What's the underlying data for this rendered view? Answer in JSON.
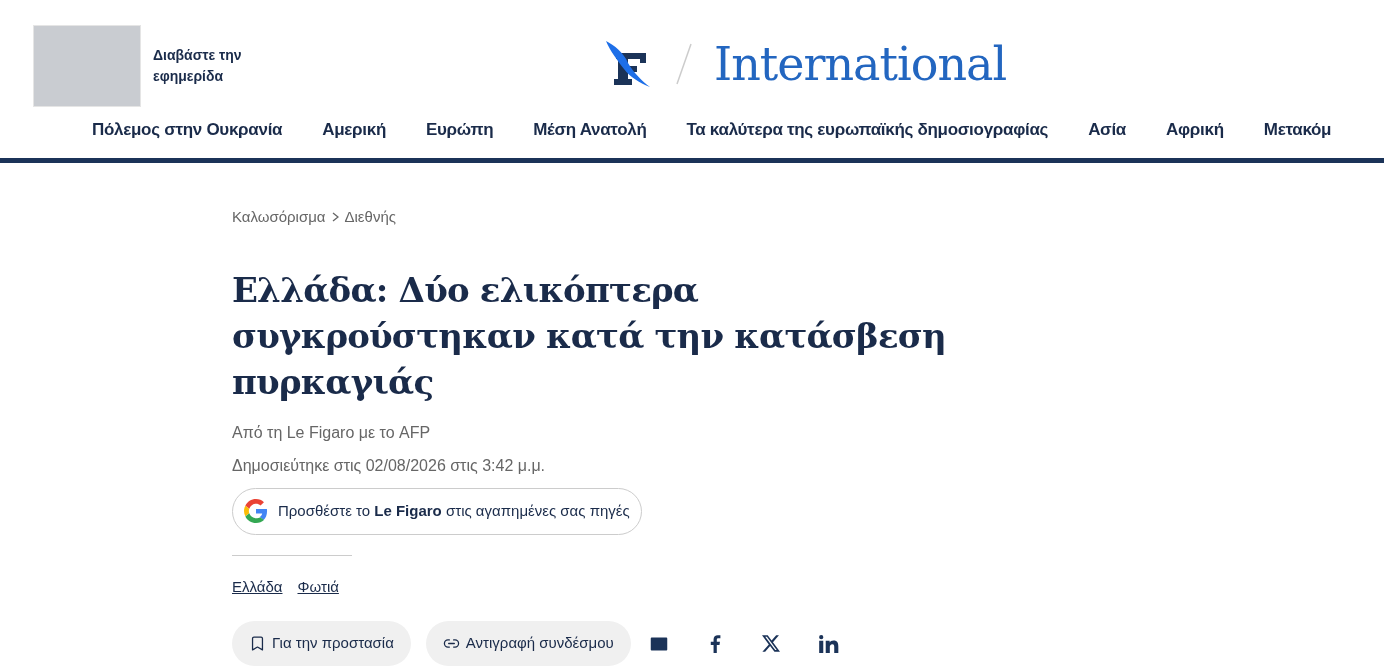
{
  "header": {
    "newspaper_link": "Διαβάστε την εφημερίδα",
    "section_title": "International"
  },
  "nav": [
    "Πόλεμος στην Ουκρανία",
    "Αμερική",
    "Ευρώπη",
    "Μέση Ανατολή",
    "Τα καλύτερα της ευρωπαϊκής δημοσιογραφίας",
    "Ασία",
    "Αφρική",
    "Μετακόμ"
  ],
  "breadcrumb": [
    "Καλωσόρισμα",
    "Διεθνής"
  ],
  "article": {
    "title": "Ελλάδα: Δύο ελικόπτερα συγκρούστηκαν κατά την κατάσβεση πυρκαγιάς",
    "byline": "Από τη Le Figaro με το AFP",
    "published": "Δημοσιεύτηκε στις 02/08/2026 στις 3:42 μ.μ.",
    "google_button": "Προσθέστε το **Le Figaro** στις αγαπημένες σας πηγές",
    "tags": [
      "Ελλάδα",
      "Φωτιά"
    ],
    "actions": [
      "Για την προστασία",
      "Αντιγραφή συνδέσμου"
    ]
  }
}
